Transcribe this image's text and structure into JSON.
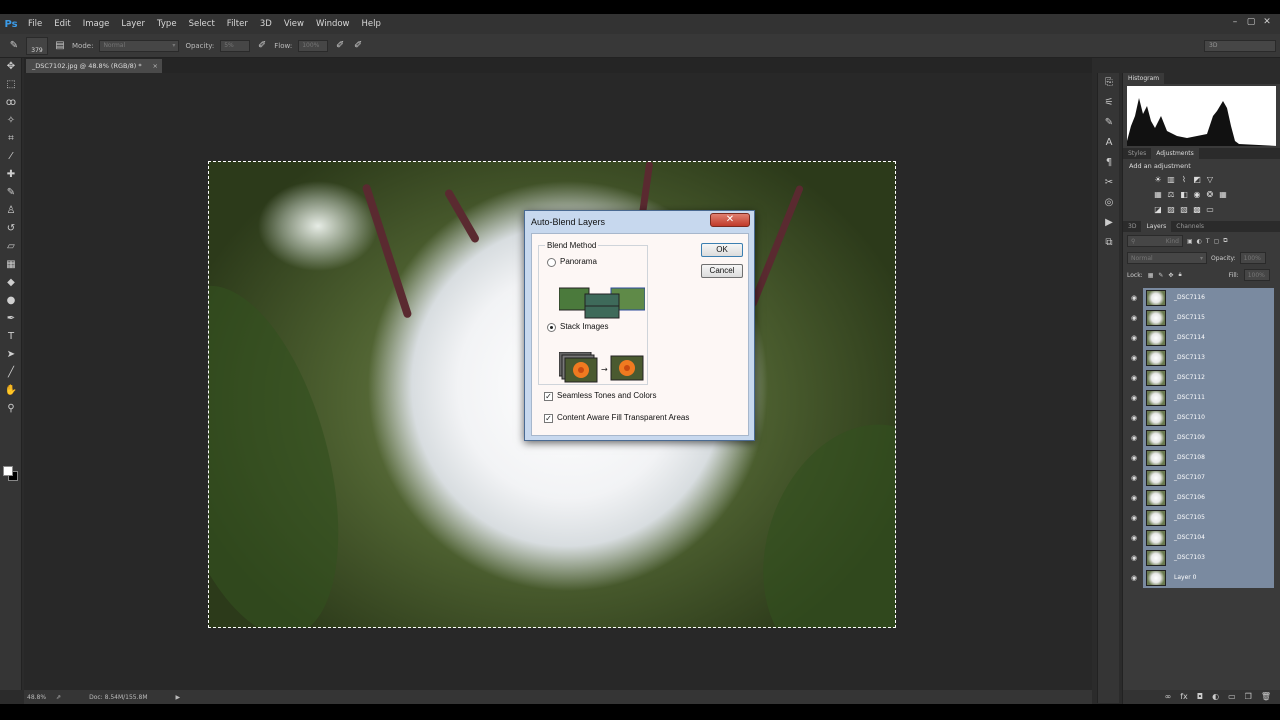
{
  "app": {
    "logo": "Ps",
    "menu": [
      "File",
      "Edit",
      "Image",
      "Layer",
      "Type",
      "Select",
      "Filter",
      "3D",
      "View",
      "Window",
      "Help"
    ],
    "window_controls": [
      "–",
      "▢",
      "✕"
    ]
  },
  "options_bar": {
    "brush_size": "379",
    "mode_label": "Mode:",
    "mode_value": "Normal",
    "opacity_label": "Opacity:",
    "opacity_value": "5%",
    "flow_label": "Flow:",
    "flow_value": "100%",
    "workspace": "3D"
  },
  "document": {
    "tab_title": "_DSC7102.jpg @ 48.8% (RGB/8) *",
    "tab_close": "×"
  },
  "status_bar": {
    "zoom": "48.8%",
    "doc_info": "Doc: 8.54M/155.8M"
  },
  "panels": {
    "histogram_tab": "Histogram",
    "adjustments_tabs": [
      "Styles",
      "Adjustments"
    ],
    "add_adjustment": "Add an adjustment",
    "layers_tabs": [
      "3D",
      "Layers",
      "Channels"
    ],
    "kind_label": "Kind",
    "blend_mode": "Normal",
    "opacity_label": "Opacity:",
    "opacity_value": "100%",
    "lock_label": "Lock:",
    "fill_label": "Fill:",
    "fill_value": "100%",
    "layers": [
      "_DSC7116",
      "_DSC7115",
      "_DSC7114",
      "_DSC7113",
      "_DSC7112",
      "_DSC7111",
      "_DSC7110",
      "_DSC7109",
      "_DSC7108",
      "_DSC7107",
      "_DSC7106",
      "_DSC7105",
      "_DSC7104",
      "_DSC7103",
      "Layer 0"
    ]
  },
  "dialog": {
    "title": "Auto-Blend Layers",
    "close": "✕",
    "group_label": "Blend Method",
    "option_panorama": "Panorama",
    "option_stack": "Stack Images",
    "selected": "Stack Images",
    "seamless_label": "Seamless Tones and Colors",
    "seamless_checked": true,
    "content_aware_label": "Content Aware Fill Transparent Areas",
    "content_aware_checked": true,
    "ok_label": "OK",
    "cancel_label": "Cancel"
  }
}
